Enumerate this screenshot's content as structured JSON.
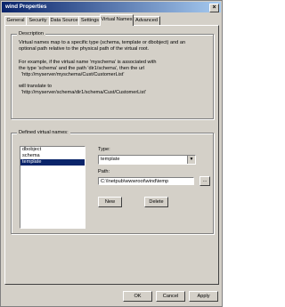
{
  "window": {
    "title": "wind Properties",
    "close_glyph": "×"
  },
  "tabs": [
    {
      "label": "General"
    },
    {
      "label": "Security"
    },
    {
      "label": "Data Source"
    },
    {
      "label": "Settings"
    },
    {
      "label": "Virtual Names"
    },
    {
      "label": "Advanced"
    }
  ],
  "active_tab": "Virtual Names",
  "description": {
    "group_label": "Description",
    "lines": [
      "Virtual names map to a specific type (schema, template or dbobject) and an",
      "optional path relative to the physical path of the virtual root.",
      "For example, if the virtual name 'myschema' is associated with",
      "the type 'schema' and the path 'dir1/schema', then the url",
      "  'http://myserver/myschema/Cust/CustomerList'",
      "will translate to",
      "  'http://myserver/schema/dir1/schema/Cust/CustomerList'"
    ]
  },
  "defined": {
    "group_label": "Defined virtual names:",
    "items": [
      "dbobject",
      "schema",
      "template"
    ],
    "selected": "template",
    "type_label": "Type:",
    "type_value": "template",
    "path_label": "Path:",
    "path_value": "C:\\Inetpub\\wwwroot\\wind\\temp",
    "browse_label": "...",
    "new_label": "New",
    "delete_label": "Delete"
  },
  "buttons": {
    "ok": "OK",
    "cancel": "Cancel",
    "apply": "Apply"
  }
}
